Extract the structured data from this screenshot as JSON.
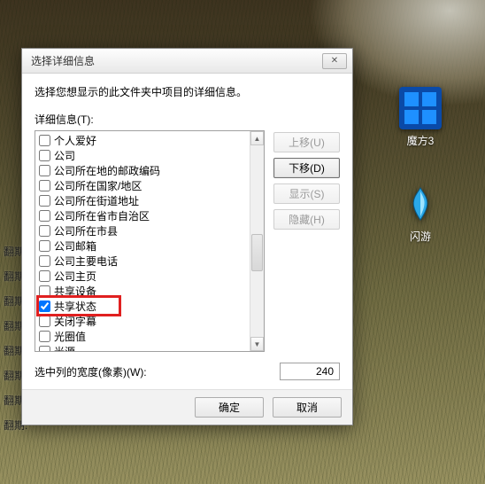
{
  "desktop": {
    "icons": [
      {
        "name": "mofang",
        "label": "魔方3"
      },
      {
        "name": "shanyou",
        "label": "闪游"
      }
    ]
  },
  "bg_list_text": "翻期.",
  "dialog": {
    "title": "选择详细信息",
    "instruction": "选择您想显示的此文件夹中项目的详细信息。",
    "details_label": "详细信息(T):",
    "items": [
      {
        "label": "个人爱好",
        "checked": false
      },
      {
        "label": "公司",
        "checked": false
      },
      {
        "label": "公司所在地的邮政编码",
        "checked": false
      },
      {
        "label": "公司所在国家/地区",
        "checked": false
      },
      {
        "label": "公司所在街道地址",
        "checked": false
      },
      {
        "label": "公司所在省市自治区",
        "checked": false
      },
      {
        "label": "公司所在市县",
        "checked": false
      },
      {
        "label": "公司邮箱",
        "checked": false
      },
      {
        "label": "公司主要电话",
        "checked": false
      },
      {
        "label": "公司主页",
        "checked": false
      },
      {
        "label": "共享设备",
        "checked": false
      },
      {
        "label": "共享状态",
        "checked": true
      },
      {
        "label": "关闭字幕",
        "checked": false
      },
      {
        "label": "光圈值",
        "checked": false
      },
      {
        "label": "光源",
        "checked": false
      }
    ],
    "highlight_index": 11,
    "side_buttons": {
      "move_up": "上移(U)",
      "move_down": "下移(D)",
      "show": "显示(S)",
      "hide": "隐藏(H)"
    },
    "width_label": "选中列的宽度(像素)(W):",
    "width_value": "240",
    "ok": "确定",
    "cancel": "取消"
  }
}
